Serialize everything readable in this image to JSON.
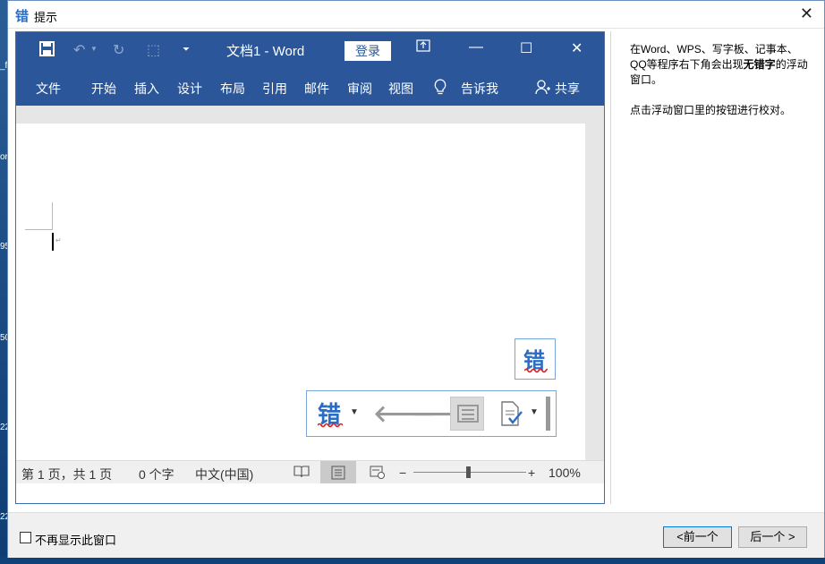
{
  "desktop": {
    "fragments": [
      "_f",
      "or",
      "95",
      "50",
      "22",
      "22"
    ]
  },
  "dialog": {
    "icon_char": "错",
    "title": "提示",
    "close_glyph": "✕"
  },
  "word": {
    "doc_title": "文档1  -  Word",
    "login": "登录",
    "tabs": [
      "文件",
      "开始",
      "插入",
      "设计",
      "布局",
      "引用",
      "邮件",
      "审阅",
      "视图"
    ],
    "tell_me": "告诉我",
    "share": "共享",
    "float_icon_char": "错",
    "status": {
      "page": "第 1 页，共 1 页",
      "words": "0 个字",
      "lang": "中文(中国)",
      "zoom": "100%",
      "zoom_minus": "−",
      "zoom_plus": "+"
    }
  },
  "help": {
    "p1_prefix": "在Word、WPS、写字板、记事本、QQ等程序右下角会出现",
    "p1_bold": "无错字",
    "p1_suffix": "的浮动窗口。",
    "p2": "点击浮动窗口里的按钮进行校对。"
  },
  "footer": {
    "checkbox_label": "不再显示此窗口",
    "prev": "<前一个",
    "next": "后一个 >"
  },
  "colors": {
    "word_blue": "#2b579a",
    "accent": "#2b6cc4",
    "squiggle": "#e02020"
  }
}
